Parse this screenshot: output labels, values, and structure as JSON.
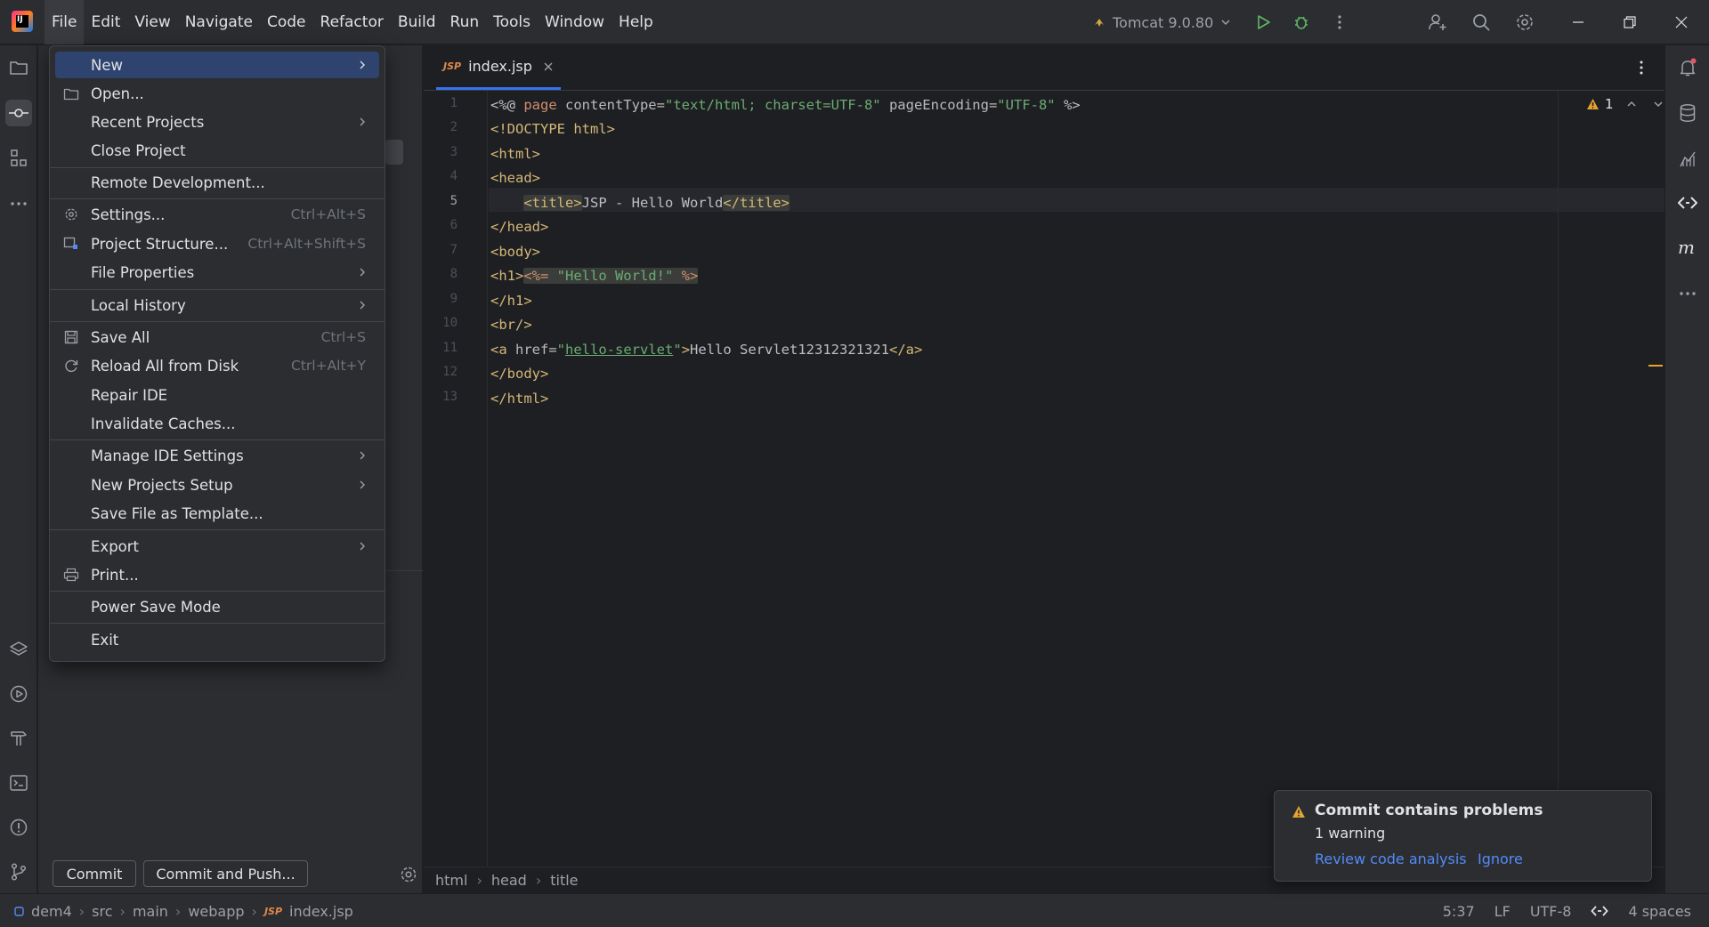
{
  "menubar": {
    "items": [
      "File",
      "Edit",
      "View",
      "Navigate",
      "Code",
      "Refactor",
      "Build",
      "Run",
      "Tools",
      "Window",
      "Help"
    ]
  },
  "toolbar": {
    "run_config": "Tomcat 9.0.80"
  },
  "file_menu": {
    "items": [
      {
        "label": "New",
        "shortcut": "",
        "submenu": true,
        "icon": ""
      },
      {
        "label": "Open...",
        "shortcut": "",
        "submenu": false,
        "icon": "folder-icon"
      },
      {
        "label": "Recent Projects",
        "shortcut": "",
        "submenu": true,
        "icon": ""
      },
      {
        "label": "Close Project",
        "shortcut": "",
        "submenu": false,
        "icon": ""
      },
      {
        "label": "Remote Development...",
        "shortcut": "",
        "submenu": false,
        "icon": ""
      },
      {
        "label": "Settings...",
        "shortcut": "Ctrl+Alt+S",
        "submenu": false,
        "icon": "gear-icon"
      },
      {
        "label": "Project Structure...",
        "shortcut": "Ctrl+Alt+Shift+S",
        "submenu": false,
        "icon": "project-structure-icon"
      },
      {
        "label": "File Properties",
        "shortcut": "",
        "submenu": true,
        "icon": ""
      },
      {
        "label": "Local History",
        "shortcut": "",
        "submenu": true,
        "icon": ""
      },
      {
        "label": "Save All",
        "shortcut": "Ctrl+S",
        "submenu": false,
        "icon": "save-icon"
      },
      {
        "label": "Reload All from Disk",
        "shortcut": "Ctrl+Alt+Y",
        "submenu": false,
        "icon": "reload-icon"
      },
      {
        "label": "Repair IDE",
        "shortcut": "",
        "submenu": false,
        "icon": ""
      },
      {
        "label": "Invalidate Caches...",
        "shortcut": "",
        "submenu": false,
        "icon": ""
      },
      {
        "label": "Manage IDE Settings",
        "shortcut": "",
        "submenu": true,
        "icon": ""
      },
      {
        "label": "New Projects Setup",
        "shortcut": "",
        "submenu": true,
        "icon": ""
      },
      {
        "label": "Save File as Template...",
        "shortcut": "",
        "submenu": false,
        "icon": ""
      },
      {
        "label": "Export",
        "shortcut": "",
        "submenu": true,
        "icon": ""
      },
      {
        "label": "Print...",
        "shortcut": "",
        "submenu": false,
        "icon": "print-icon"
      },
      {
        "label": "Power Save Mode",
        "shortcut": "",
        "submenu": false,
        "icon": ""
      },
      {
        "label": "Exit",
        "shortcut": "",
        "submenu": false,
        "icon": ""
      }
    ]
  },
  "commit_panel": {
    "commit_label": "Commit",
    "commit_push_label": "Commit and Push..."
  },
  "editor": {
    "tab_label": "index.jsp",
    "tab_type": "JSP",
    "line_numbers": [
      "1",
      "2",
      "3",
      "4",
      "5",
      "6",
      "7",
      "8",
      "9",
      "10",
      "11",
      "12",
      "13"
    ],
    "current_line": 5,
    "warning_count": "1"
  },
  "code": {
    "l1": {
      "a": "<%@ ",
      "b": "page",
      "c": " contentType=",
      "d": "\"text/html; charset=UTF-8\"",
      "e": " pageEncoding=",
      "f": "\"UTF-8\"",
      "g": " %>"
    },
    "l2": "<!DOCTYPE html>",
    "l3": "<html>",
    "l4": "<head>",
    "l5": {
      "indent": "    ",
      "open": "<title>",
      "text": "JSP - Hello World",
      "close": "</title>"
    },
    "l6": "</head>",
    "l7": "<body>",
    "l8": {
      "open": "<h1>",
      "a": "<%= ",
      "b": "\"Hello World!\"",
      "c": " %>"
    },
    "l9": "</h1>",
    "l10": "<br/>",
    "l11": {
      "a": "<a ",
      "b": "href=",
      "q1": "\"",
      "c": "hello-servlet",
      "q2": "\"",
      "d": ">",
      "e": "Hello Servlet12312321321",
      "f": "</a>"
    },
    "l12": "</body>",
    "l13": "</html>"
  },
  "breadcrumb": [
    "html",
    "head",
    "title"
  ],
  "statusbar": {
    "path": [
      "dem4",
      "src",
      "main",
      "webapp",
      "index.jsp"
    ],
    "position": "5:37",
    "line_sep": "LF",
    "encoding": "UTF-8",
    "indent": "4 spaces"
  },
  "notification": {
    "title": "Commit contains problems",
    "body": "1 warning",
    "link_review": "Review code analysis",
    "link_ignore": "Ignore"
  },
  "colors": {
    "accent": "#3574f0",
    "selection": "#2e436e",
    "warning": "#e5a430",
    "link": "#548af7"
  }
}
